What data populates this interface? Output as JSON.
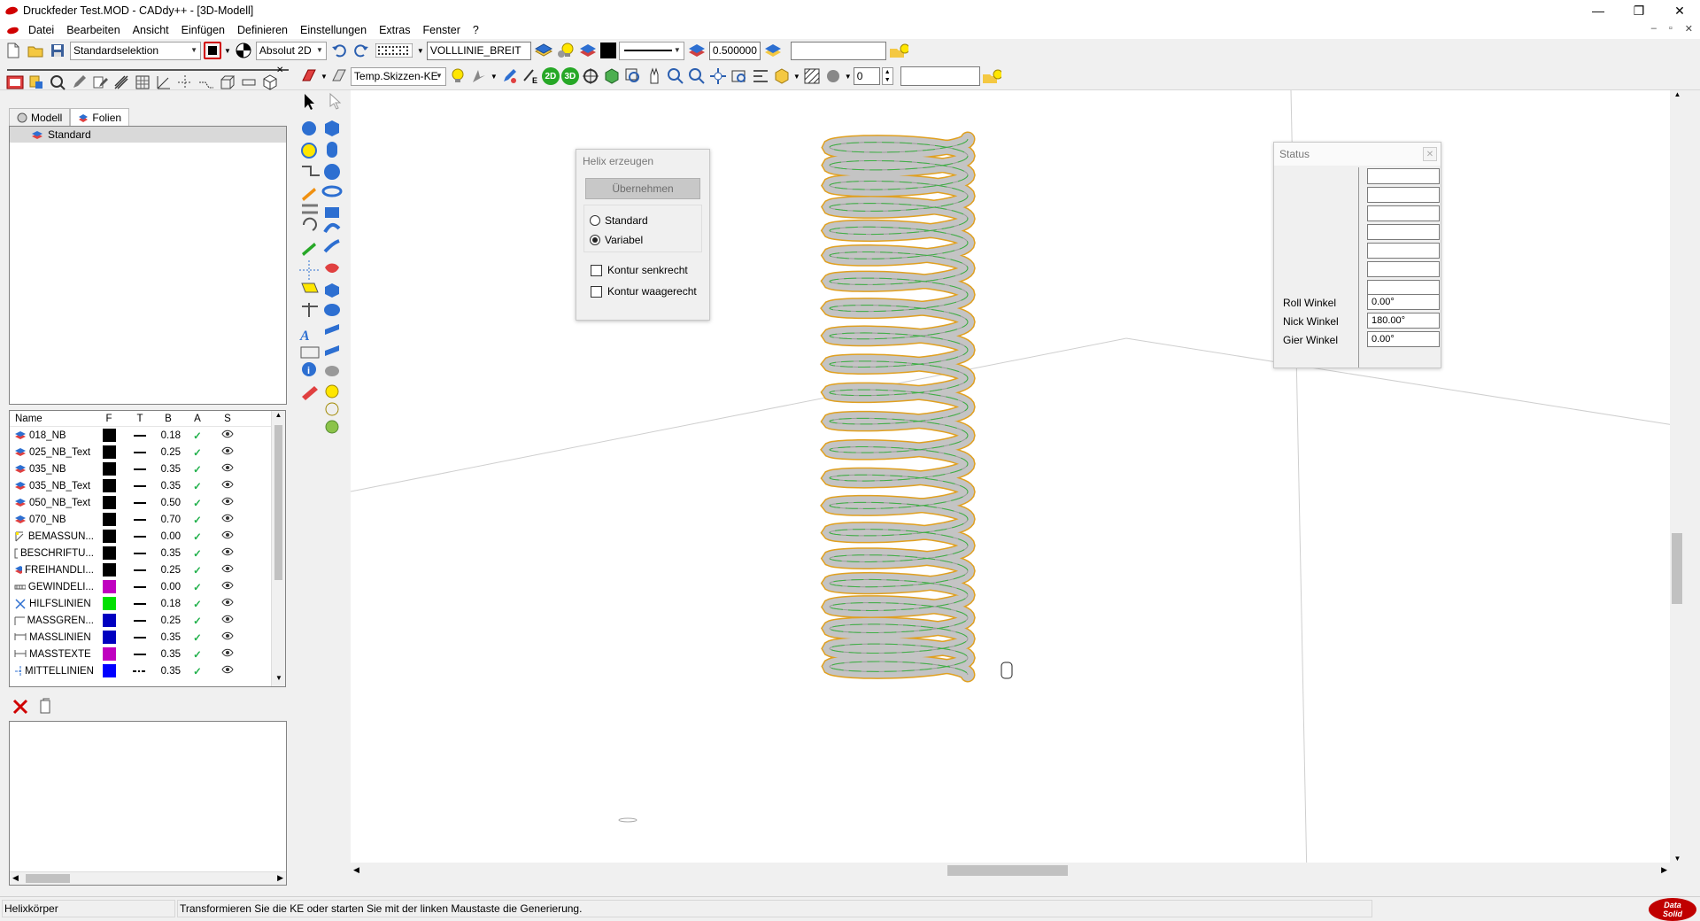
{
  "window": {
    "title": "Druckfeder Test.MOD  -  CADdy++ - [3D-Modell]",
    "buttons": [
      "—",
      "❐",
      "✕"
    ]
  },
  "menu": {
    "items": [
      "Datei",
      "Bearbeiten",
      "Ansicht",
      "Einfügen",
      "Definieren",
      "Einstellungen",
      "Extras",
      "Fenster",
      "?"
    ],
    "mdi_buttons": [
      "–",
      "▫",
      "✕"
    ]
  },
  "toolbar1": {
    "selection_mode": "Standardselektion",
    "coord_mode": "Absolut 2D",
    "line_type": "VOLLLINIE_BREIT",
    "line_width": "0.500000",
    "search_value": ""
  },
  "toolbar2": {
    "sketch_plane": "Temp.Skizzen-KE",
    "btn_2d": "2D",
    "btn_3d": "3D",
    "counter": "0",
    "search_value": ""
  },
  "left_panel": {
    "tabs": [
      "Modell",
      "Folien"
    ],
    "active_tab": "Folien",
    "tree_root": "Standard",
    "table_headers": [
      "Name",
      "F",
      "T",
      "B",
      "A",
      "S"
    ],
    "layers": [
      {
        "name": "018_NB",
        "color": "#000000",
        "line": "solid",
        "width": "0.18",
        "icon": "layer-icon"
      },
      {
        "name": "025_NB_Text",
        "color": "#000000",
        "line": "solid",
        "width": "0.25",
        "icon": "layer-icon"
      },
      {
        "name": "035_NB",
        "color": "#000000",
        "line": "solid",
        "width": "0.35",
        "icon": "layer-icon"
      },
      {
        "name": "035_NB_Text",
        "color": "#000000",
        "line": "solid",
        "width": "0.35",
        "icon": "layer-icon"
      },
      {
        "name": "050_NB_Text",
        "color": "#000000",
        "line": "solid",
        "width": "0.50",
        "icon": "layer-icon"
      },
      {
        "name": "070_NB",
        "color": "#000000",
        "line": "solid",
        "width": "0.70",
        "icon": "layer-icon"
      },
      {
        "name": "BEMASSUN...",
        "color": "#000000",
        "line": "solid",
        "width": "0.00",
        "icon": "dimension-icon"
      },
      {
        "name": "BESCHRIFTU...",
        "color": "#000000",
        "line": "solid",
        "width": "0.35",
        "icon": "text-edit-icon"
      },
      {
        "name": "FREIHANDLI...",
        "color": "#000000",
        "line": "solid",
        "width": "0.25",
        "icon": "layer-icon"
      },
      {
        "name": "GEWINDELI...",
        "color": "#c000c0",
        "line": "solid",
        "width": "0.00",
        "icon": "thread-icon"
      },
      {
        "name": "HILFSLINIEN",
        "color": "#00e000",
        "line": "solid",
        "width": "0.18",
        "icon": "helper-lines-icon"
      },
      {
        "name": "MASSGREN...",
        "color": "#0000c0",
        "line": "solid",
        "width": "0.25",
        "icon": "dim-limit-icon"
      },
      {
        "name": "MASSLINIEN",
        "color": "#0000c0",
        "line": "solid",
        "width": "0.35",
        "icon": "dim-line-icon"
      },
      {
        "name": "MASSTEXTE",
        "color": "#c000c0",
        "line": "solid",
        "width": "0.35",
        "icon": "dim-text-icon"
      },
      {
        "name": "MITTELLINIEN",
        "color": "#0000ff",
        "line": "dashdot",
        "width": "0.35",
        "icon": "center-line-icon"
      }
    ]
  },
  "helix_dialog": {
    "title": "Helix erzeugen",
    "apply_label": "Übernehmen",
    "options": [
      {
        "label": "Standard",
        "selected": false
      },
      {
        "label": "Variabel",
        "selected": true
      }
    ],
    "checkboxes": [
      {
        "label": "Kontur senkrecht",
        "checked": false
      },
      {
        "label": "Kontur waagerecht",
        "checked": false
      }
    ]
  },
  "status_dialog": {
    "title": "Status",
    "close": "✕",
    "empty_fields": 7,
    "fields": [
      {
        "label": "Roll Winkel",
        "value": "0.00°"
      },
      {
        "label": "Nick Winkel",
        "value": "180.00°"
      },
      {
        "label": "Gier Winkel",
        "value": "0.00°"
      }
    ]
  },
  "statusbar": {
    "left": "Helixkörper",
    "message": "Transformieren Sie die KE oder starten Sie mit der linken Maustaste die Generierung.",
    "logo_line1": "Data",
    "logo_line2": "Solid"
  },
  "colors": {
    "spring_fill": "#c4c4c4",
    "spring_edge": "#e0a020",
    "spring_center": "#3cb043",
    "accent_red": "#d00000",
    "check_green": "#22b14c"
  }
}
